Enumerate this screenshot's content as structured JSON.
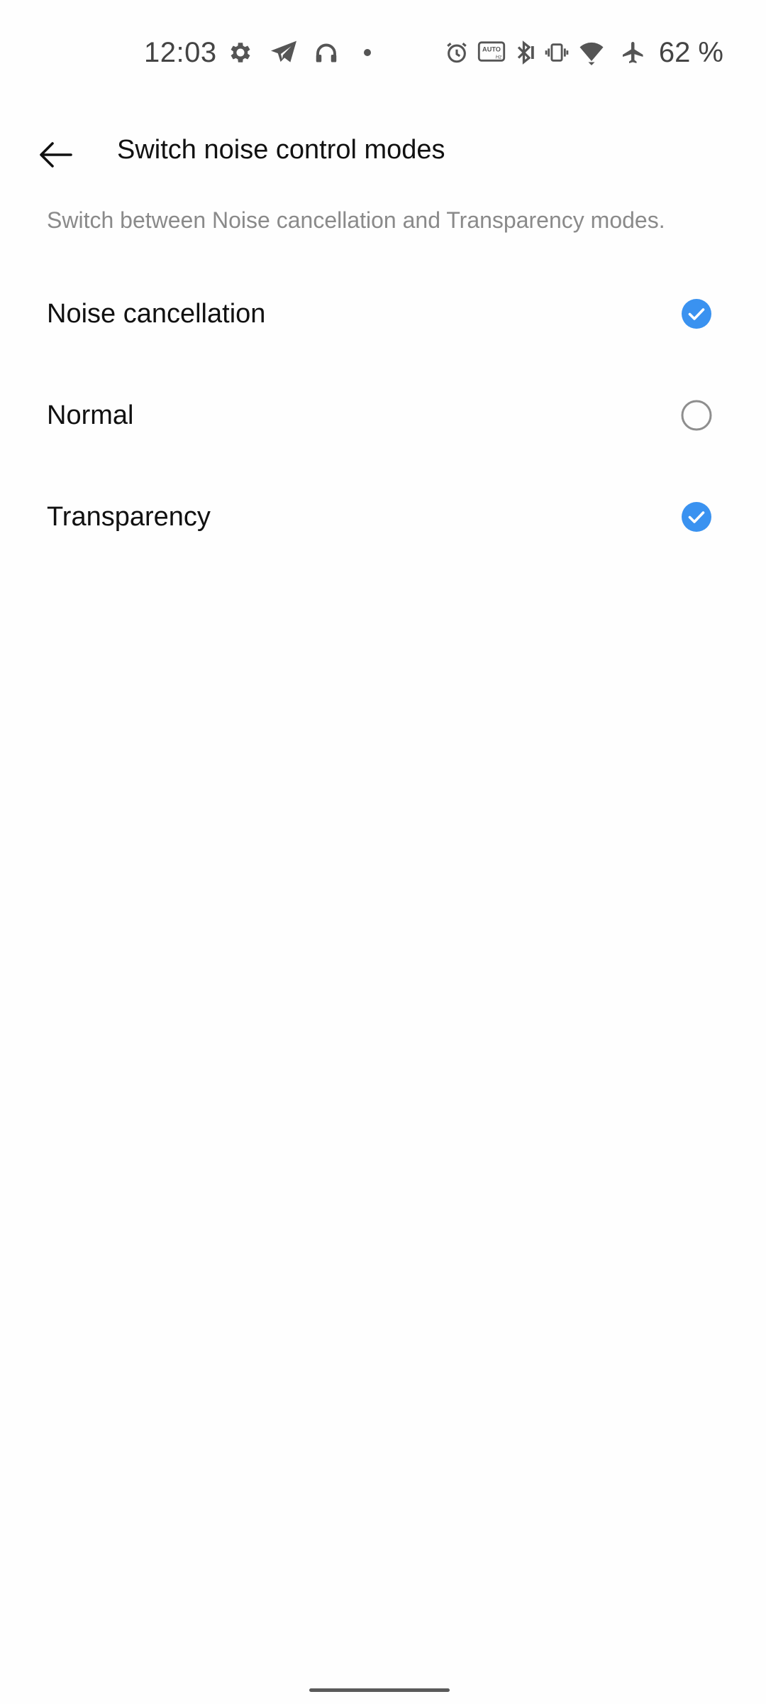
{
  "status_bar": {
    "time": "12:03",
    "battery": "62 %",
    "left_icons": [
      "gear-icon",
      "telegram-icon",
      "headphones-icon",
      "dot-icon"
    ],
    "right_icons": [
      "alarm-icon",
      "auto-hz-icon",
      "bluetooth-icon",
      "vibrate-icon",
      "wifi-icon",
      "airplane-icon"
    ]
  },
  "header": {
    "title": "Switch noise control modes",
    "back_icon": "arrow-left-icon"
  },
  "description": "Switch between Noise cancellation and Transparency modes.",
  "options": [
    {
      "label": "Noise cancellation",
      "checked": true
    },
    {
      "label": "Normal",
      "checked": false
    },
    {
      "label": "Transparency",
      "checked": true
    }
  ],
  "colors": {
    "accent": "#3a92f0",
    "unchecked_border": "#8e8e8e",
    "secondary_text": "#8a8a8a"
  }
}
